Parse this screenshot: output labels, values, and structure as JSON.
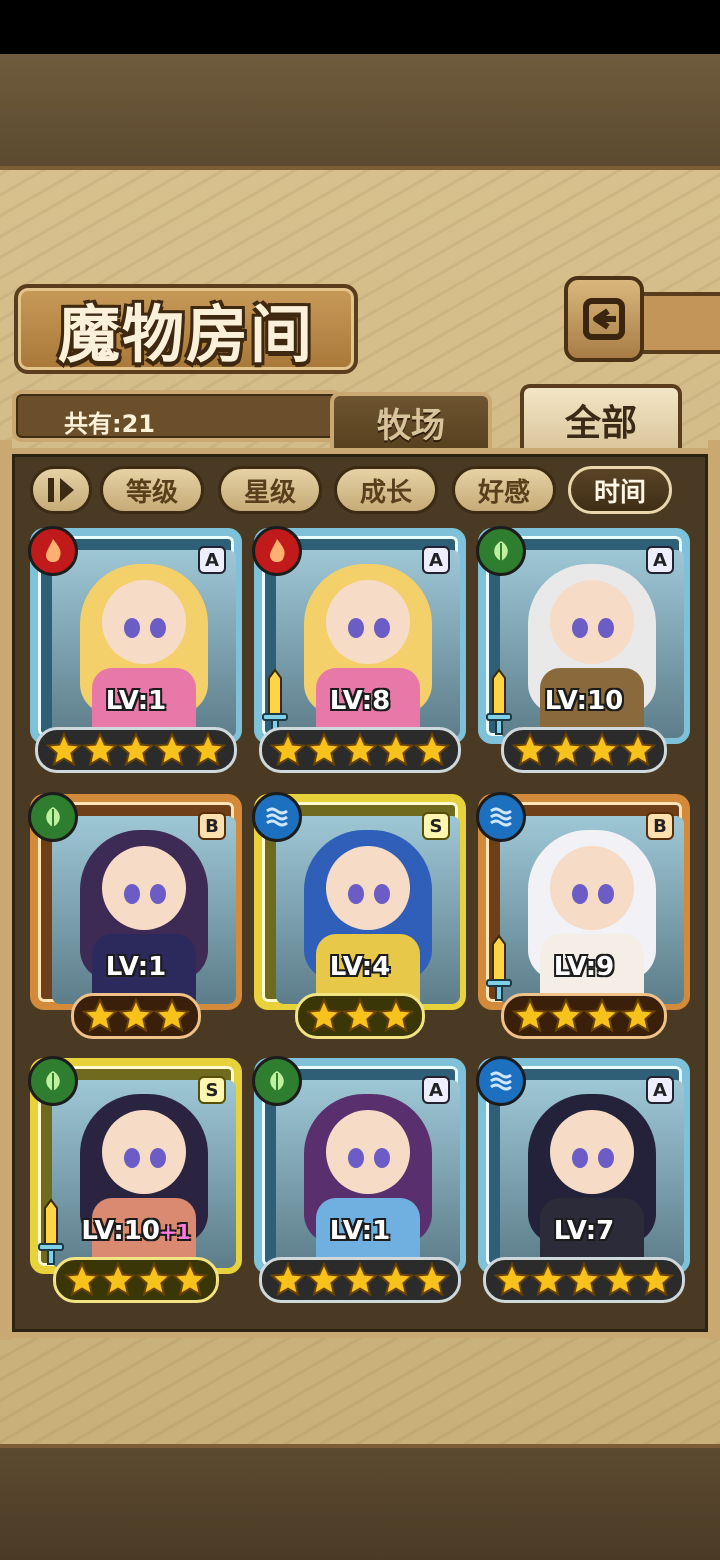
{
  "title": "魔物房间",
  "count_label": "共有:21",
  "tabs": {
    "ranch": "牧场",
    "all": "全部"
  },
  "sort_buttons": [
    {
      "label": "等级",
      "active": false
    },
    {
      "label": "星级",
      "active": false
    },
    {
      "label": "成长",
      "active": false
    },
    {
      "label": "好感",
      "active": false
    },
    {
      "label": "时间",
      "active": true
    }
  ],
  "colors": {
    "fire": "#c01a1a",
    "leaf": "#2f7d2f",
    "water": "#1d6fbf",
    "star": "#f7c21b"
  },
  "cards": [
    {
      "element": "fire-icon",
      "rarity": "A",
      "level": "LV:1",
      "bonus": "",
      "stars": 5,
      "sword": false,
      "hair": "#f3d06a",
      "outfit": "#e878a8"
    },
    {
      "element": "fire-icon",
      "rarity": "A",
      "level": "LV:8",
      "bonus": "",
      "stars": 5,
      "sword": true,
      "hair": "#f3d06a",
      "outfit": "#e878a8"
    },
    {
      "element": "leaf-icon",
      "rarity": "A",
      "level": "LV:10",
      "bonus": "",
      "stars": 4,
      "sword": true,
      "hair": "#e9e9e9",
      "outfit": "#8a6a3c"
    },
    {
      "element": "leaf-icon",
      "rarity": "B",
      "level": "LV:1",
      "bonus": "",
      "stars": 3,
      "sword": false,
      "hair": "#3d2a55",
      "outfit": "#2c2a5c"
    },
    {
      "element": "water-icon",
      "rarity": "S",
      "level": "LV:4",
      "bonus": "",
      "stars": 3,
      "sword": false,
      "hair": "#2f5fb8",
      "outfit": "#e8c848"
    },
    {
      "element": "water-icon",
      "rarity": "B",
      "level": "LV:9",
      "bonus": "",
      "stars": 4,
      "sword": true,
      "hair": "#f1f1f6",
      "outfit": "#f4eee6"
    },
    {
      "element": "leaf-icon",
      "rarity": "S",
      "level": "LV:10",
      "bonus": "+1",
      "stars": 4,
      "sword": true,
      "hair": "#2a2440",
      "outfit": "#d98a70"
    },
    {
      "element": "leaf-icon",
      "rarity": "A",
      "level": "LV:1",
      "bonus": "",
      "stars": 5,
      "sword": false,
      "hair": "#5a2f6e",
      "outfit": "#6fb0e0"
    },
    {
      "element": "water-icon",
      "rarity": "A",
      "level": "LV:7",
      "bonus": "",
      "stars": 5,
      "sword": false,
      "hair": "#23223a",
      "outfit": "#2b2b3a"
    }
  ]
}
